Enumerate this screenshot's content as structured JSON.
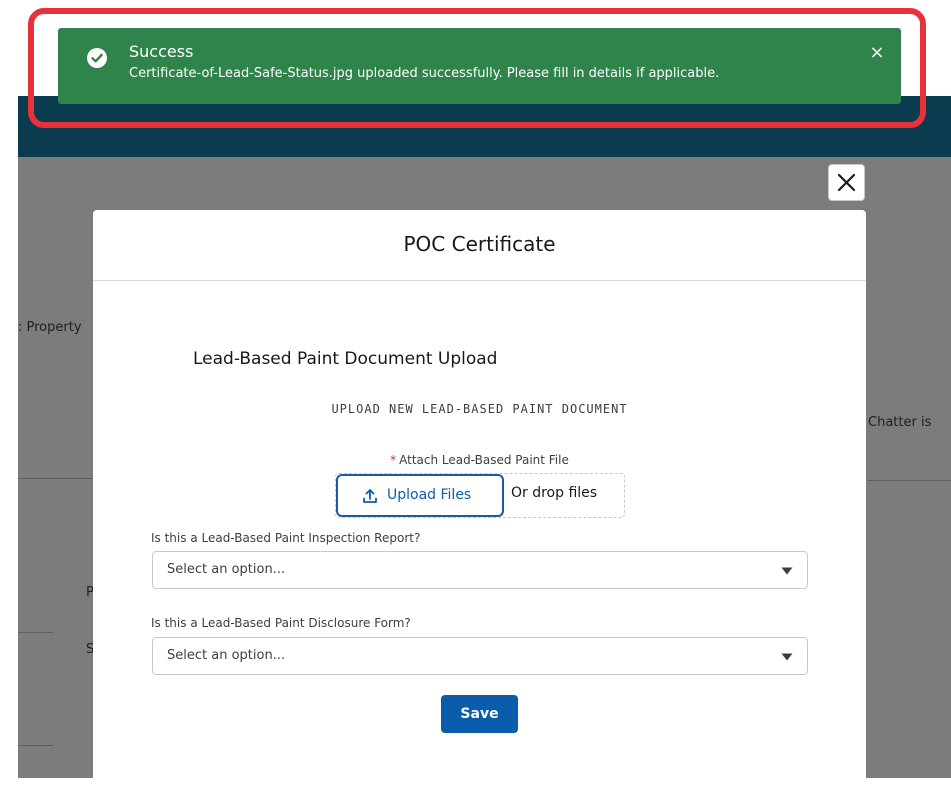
{
  "toast": {
    "title": "Success",
    "message": "Certificate-of-Lead-Safe-Status.jpg uploaded successfully. Please fill in details if applicable.",
    "close_symbol": "×",
    "icon": "check-circle-icon",
    "color": "#2e844a"
  },
  "background": {
    "property_text": ": Property",
    "chatter_text": "Chatter is",
    "p_text": "P",
    "s_text": "S",
    "header_color": "#0b3b4e"
  },
  "modal": {
    "title": "POC Certificate",
    "close_icon": "close-icon",
    "section_title": "Lead-Based Paint Document Upload",
    "upload_heading": "UPLOAD NEW LEAD-BASED PAINT DOCUMENT",
    "attach_required": "*",
    "attach_label": "Attach Lead-Based Paint File",
    "upload_button": "Upload Files",
    "drop_text": "Or drop files",
    "fields": [
      {
        "label": "Is this a Lead-Based Paint Inspection Report?",
        "placeholder": "Select an option..."
      },
      {
        "label": "Is this a Lead-Based Paint Disclosure Form?",
        "placeholder": "Select an option..."
      }
    ],
    "save_button": "Save",
    "accent_color": "#0b5cab"
  },
  "annotation": {
    "highlight_color": "#e8323b"
  }
}
